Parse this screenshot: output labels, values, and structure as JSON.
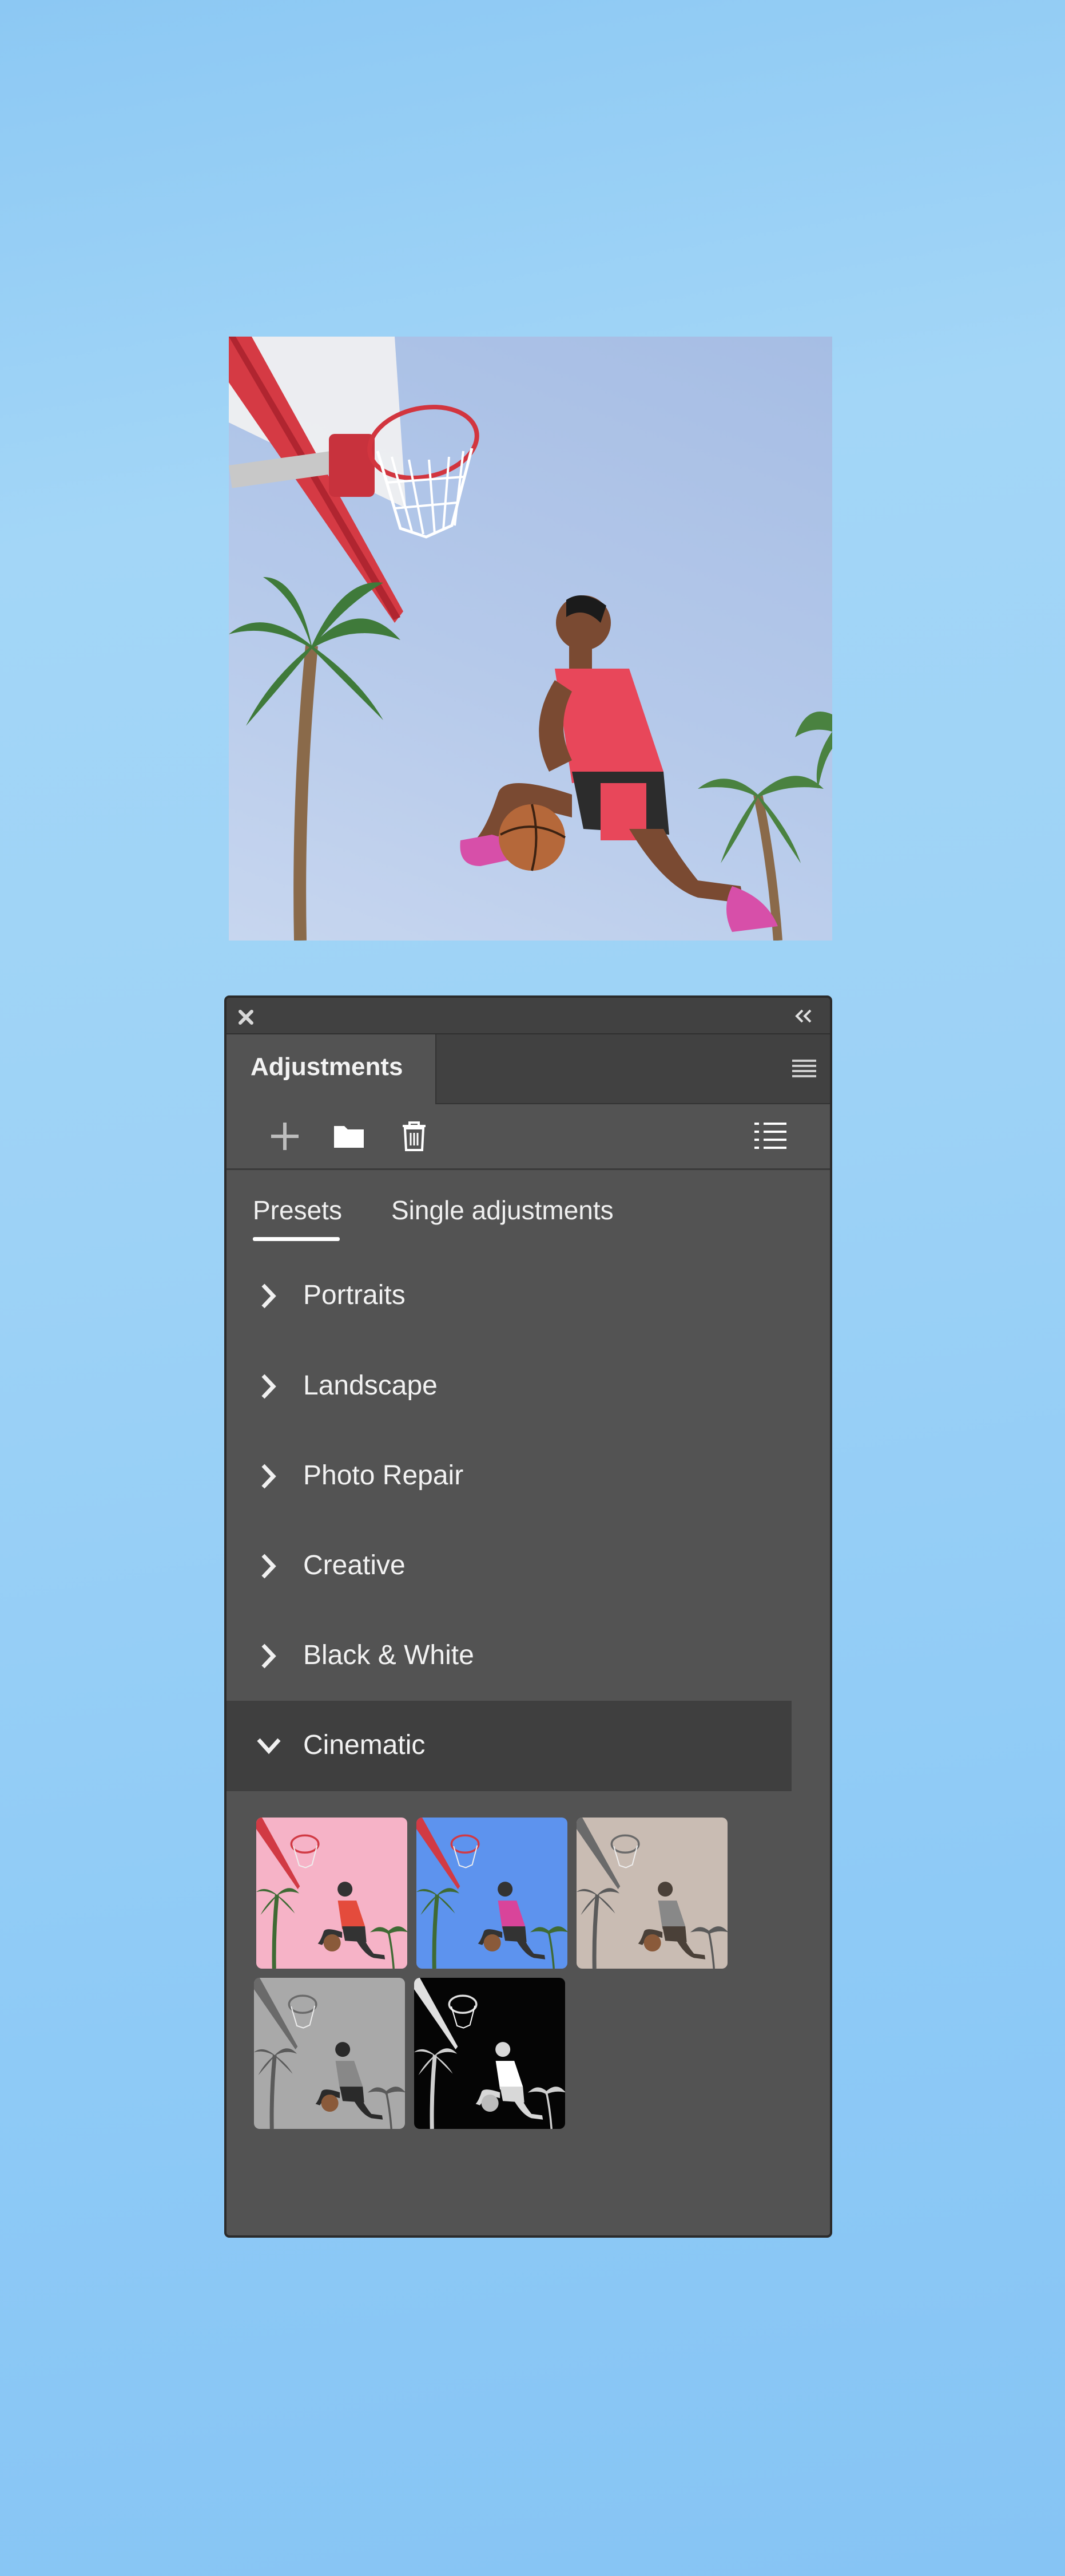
{
  "panel": {
    "tab_title": "Adjustments",
    "subtabs": {
      "presets": "Presets",
      "single": "Single adjustments"
    },
    "groups": [
      {
        "label": "Portraits",
        "expanded": false
      },
      {
        "label": "Landscape",
        "expanded": false
      },
      {
        "label": "Photo Repair",
        "expanded": false
      },
      {
        "label": "Creative",
        "expanded": false
      },
      {
        "label": "Black & White",
        "expanded": false
      },
      {
        "label": "Cinematic",
        "expanded": true
      }
    ],
    "icons": {
      "close": "close-icon",
      "collapse": "double-chevron-left-icon",
      "menu": "hamburger-menu-icon",
      "add": "plus-icon",
      "folder": "folder-icon",
      "delete": "trash-icon",
      "list": "list-icon"
    },
    "cinematic_thumbnails": [
      {
        "name": "pink tint",
        "sky": "#f6b3c7"
      },
      {
        "name": "blue tint",
        "sky": "#5d93ee"
      },
      {
        "name": "sepia fade",
        "sky": "#c9bcb3"
      },
      {
        "name": "grayscale",
        "sky": "#a9a9a9"
      },
      {
        "name": "high contrast black",
        "sky": "#050505"
      }
    ]
  },
  "colors": {
    "panel_bg": "#535353",
    "panel_header": "#414141",
    "selected_group": "#3f3f3f",
    "text": "#f1f1f1",
    "background_blue": "#9dd2f6"
  }
}
